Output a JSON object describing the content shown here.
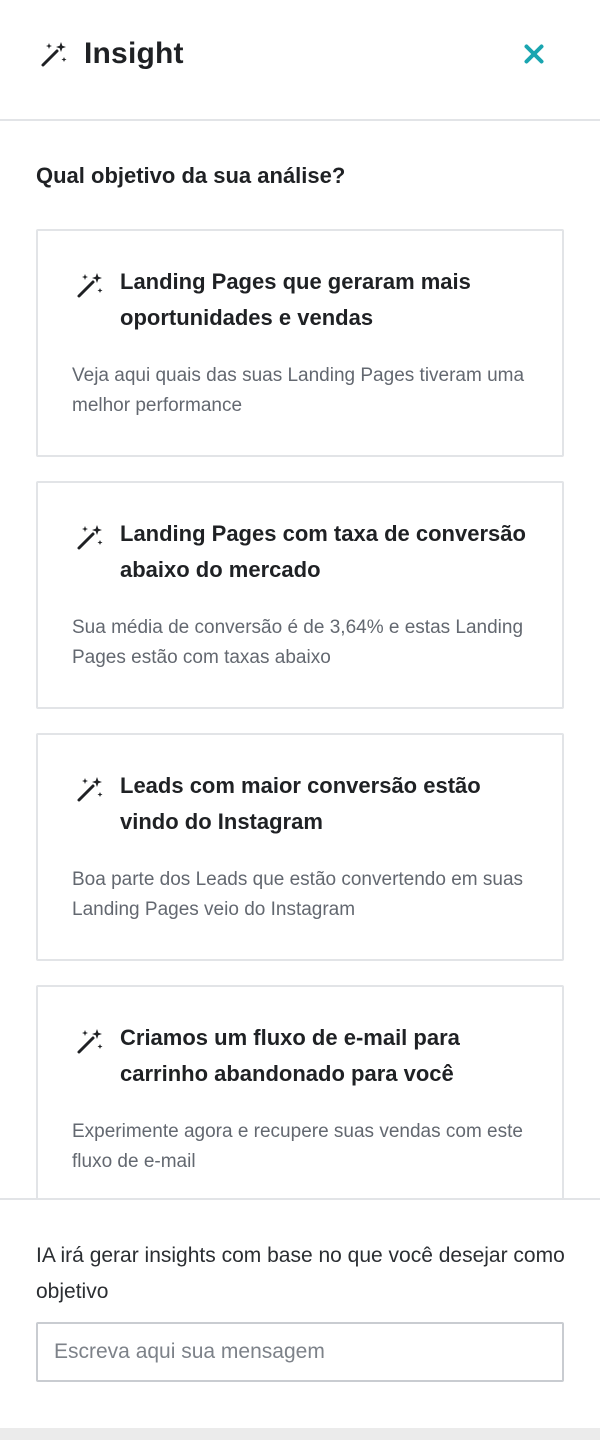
{
  "header": {
    "title": "Insight",
    "icon": "magic-wand-icon",
    "close_icon": "close-icon",
    "accent_color": "#1aa5b0"
  },
  "main": {
    "question": "Qual objetivo da sua análise?",
    "cards": [
      {
        "title": "Landing Pages que geraram mais oportunidades e vendas",
        "description": "Veja aqui quais das suas Landing Pages tiveram uma melhor performance"
      },
      {
        "title": "Landing Pages com taxa de conversão abaixo do mercado",
        "description": "Sua média de conversão é de 3,64% e estas Landing Pages estão com taxas abaixo"
      },
      {
        "title": "Leads com maior conversão estão vindo do Instagram",
        "description": "Boa parte dos Leads que estão convertendo em suas Landing Pages veio do Instagram"
      },
      {
        "title": "Criamos um fluxo de e-mail para carrinho abandonado para você",
        "description": "Experimente agora e recupere suas vendas com este fluxo de e-mail"
      }
    ]
  },
  "footer": {
    "info_text": "IA irá gerar insights com base no que você desejar como objetivo",
    "message_value": "",
    "message_placeholder": "Escreva aqui sua mensagem"
  }
}
